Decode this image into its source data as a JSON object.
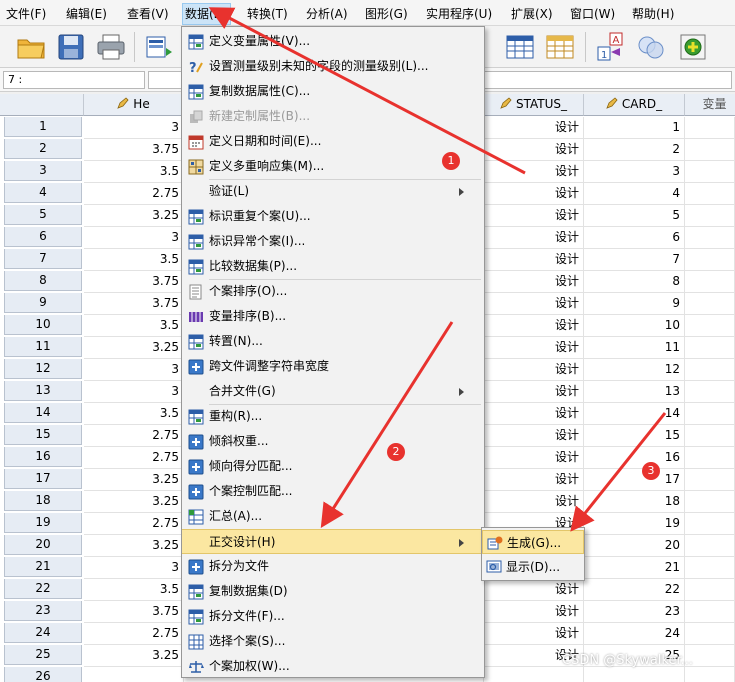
{
  "menubar": {
    "items": [
      "文件(F)",
      "编辑(E)",
      "查看(V)",
      "数据(D)",
      "转换(T)",
      "分析(A)",
      "图形(G)",
      "实用程序(U)",
      "扩展(X)",
      "窗口(W)",
      "帮助(H)"
    ]
  },
  "celleditor": {
    "ref": "7 :"
  },
  "grid": {
    "headers": {
      "he": "He",
      "status": "STATUS_",
      "card": "CARD_",
      "var": "变量"
    },
    "rows": [
      {
        "n": "1",
        "he": "3",
        "status": "设计",
        "card": "1"
      },
      {
        "n": "2",
        "he": "3.75",
        "status": "设计",
        "card": "2"
      },
      {
        "n": "3",
        "he": "3.5",
        "status": "设计",
        "card": "3"
      },
      {
        "n": "4",
        "he": "2.75",
        "status": "设计",
        "card": "4"
      },
      {
        "n": "5",
        "he": "3.25",
        "status": "设计",
        "card": "5"
      },
      {
        "n": "6",
        "he": "3",
        "status": "设计",
        "card": "6"
      },
      {
        "n": "7",
        "he": "3.5",
        "status": "设计",
        "card": "7"
      },
      {
        "n": "8",
        "he": "3.75",
        "status": "设计",
        "card": "8"
      },
      {
        "n": "9",
        "he": "3.75",
        "status": "设计",
        "card": "9"
      },
      {
        "n": "10",
        "he": "3.5",
        "status": "设计",
        "card": "10"
      },
      {
        "n": "11",
        "he": "3.25",
        "status": "设计",
        "card": "11"
      },
      {
        "n": "12",
        "he": "3",
        "status": "设计",
        "card": "12"
      },
      {
        "n": "13",
        "he": "3",
        "status": "设计",
        "card": "13"
      },
      {
        "n": "14",
        "he": "3.5",
        "status": "设计",
        "card": "14"
      },
      {
        "n": "15",
        "he": "2.75",
        "status": "设计",
        "card": "15"
      },
      {
        "n": "16",
        "he": "2.75",
        "status": "设计",
        "card": "16"
      },
      {
        "n": "17",
        "he": "3.25",
        "status": "设计",
        "card": "17"
      },
      {
        "n": "18",
        "he": "3.25",
        "status": "设计",
        "card": "18"
      },
      {
        "n": "19",
        "he": "2.75",
        "status": "设计",
        "card": "19"
      },
      {
        "n": "20",
        "he": "3.25",
        "status": "",
        "card": "20"
      },
      {
        "n": "21",
        "he": "3",
        "status": "",
        "card": "21"
      },
      {
        "n": "22",
        "he": "3.5",
        "status": "设计",
        "card": "22"
      },
      {
        "n": "23",
        "he": "3.75",
        "status": "设计",
        "card": "23"
      },
      {
        "n": "24",
        "he": "2.75",
        "status": "设计",
        "card": "24"
      },
      {
        "n": "25",
        "he": "3.25",
        "status": "设计",
        "card": "25"
      },
      {
        "n": "26",
        "he": "",
        "status": "",
        "card": ""
      }
    ]
  },
  "dropdown": {
    "items": [
      {
        "label": "定义变量属性(V)...",
        "icon": "define-properties-icon"
      },
      {
        "label": "设置测量级别未知的字段的测量级别(L)...",
        "icon": "measure-level-icon"
      },
      {
        "label": "复制数据属性(C)...",
        "icon": "copy-properties-icon"
      },
      {
        "label": "新建定制属性(B)...",
        "icon": "custom-attribute-icon",
        "disabled": true
      },
      {
        "label": "定义日期和时间(E)...",
        "icon": "calendar-icon"
      },
      {
        "label": "定义多重响应集(M)...",
        "icon": "multi-response-icon"
      },
      {
        "label": "验证(L)",
        "submenu": true
      },
      {
        "label": "标识重复个案(U)...",
        "icon": "duplicate-cases-icon"
      },
      {
        "label": "标识异常个案(I)...",
        "icon": "unusual-cases-icon"
      },
      {
        "label": "比较数据集(P)...",
        "icon": "compare-datasets-icon"
      },
      {
        "label": "个案排序(O)...",
        "icon": "sort-cases-icon"
      },
      {
        "label": "变量排序(B)...",
        "icon": "sort-variables-icon"
      },
      {
        "label": "转置(N)...",
        "icon": "transpose-icon"
      },
      {
        "label": "跨文件调整字符串宽度",
        "icon": "plus-icon"
      },
      {
        "label": "合并文件(G)",
        "submenu": true
      },
      {
        "label": "重构(R)...",
        "icon": "restructure-icon"
      },
      {
        "label": "倾斜权重...",
        "icon": "plus-icon"
      },
      {
        "label": "倾向得分匹配...",
        "icon": "plus-icon"
      },
      {
        "label": "个案控制匹配...",
        "icon": "plus-icon"
      },
      {
        "label": "汇总(A)...",
        "icon": "aggregate-icon"
      },
      {
        "label": "正交设计(H)",
        "submenu": true,
        "highlight": true
      },
      {
        "label": "拆分为文件",
        "icon": "plus-icon"
      },
      {
        "label": "复制数据集(D)",
        "icon": "copy-dataset-icon"
      },
      {
        "label": "拆分文件(F)...",
        "icon": "split-file-icon"
      },
      {
        "label": "选择个案(S)...",
        "icon": "select-cases-icon"
      },
      {
        "label": "个案加权(W)...",
        "icon": "weight-cases-icon"
      }
    ]
  },
  "submenu": {
    "items": [
      {
        "label": "生成(G)...",
        "icon": "generate-icon",
        "highlight": true
      },
      {
        "label": "显示(D)...",
        "icon": "display-icon"
      }
    ]
  },
  "annotations": {
    "badges": [
      "1",
      "2",
      "3"
    ]
  },
  "watermark": "CSDN @Skywalker...",
  "colors": {
    "annotation": "#e8322e",
    "menu_highlight": "#fbe7a1"
  }
}
